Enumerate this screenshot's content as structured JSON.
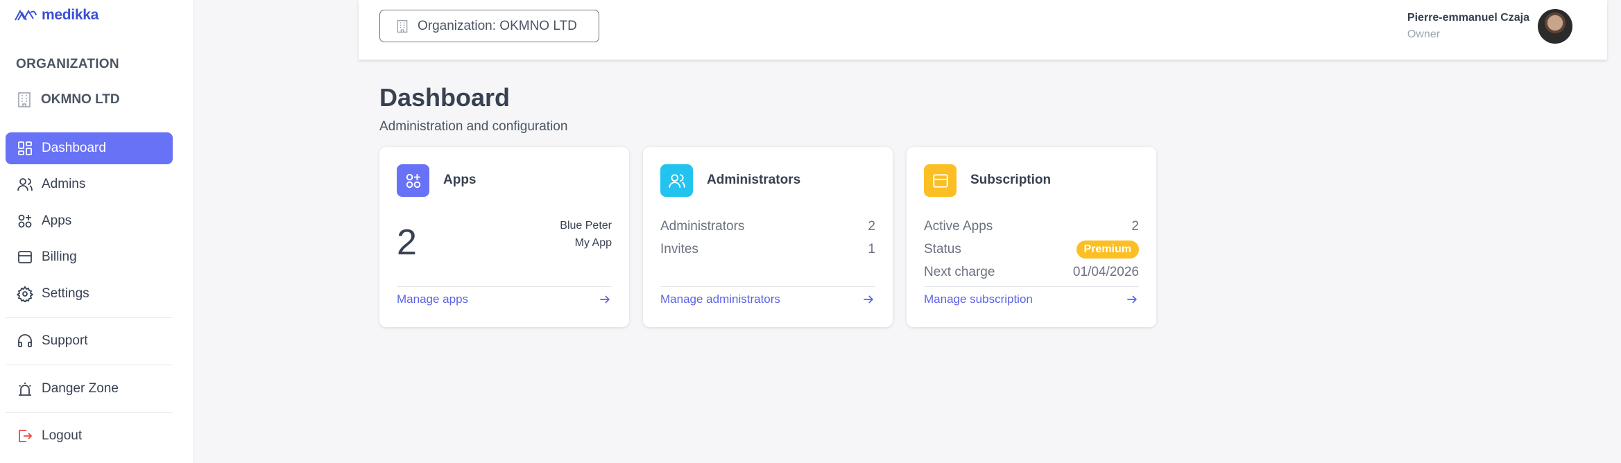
{
  "brand": {
    "name": "medikka",
    "color": "#3b4fd6"
  },
  "sidebar": {
    "section_heading": "ORGANIZATION",
    "org_name": "OKMNO LTD",
    "items": [
      {
        "label": "Dashboard",
        "icon": "dashboard-icon",
        "active": true
      },
      {
        "label": "Admins",
        "icon": "users-icon"
      },
      {
        "label": "Apps",
        "icon": "apps-icon"
      },
      {
        "label": "Billing",
        "icon": "billing-icon"
      },
      {
        "label": "Settings",
        "icon": "gear-icon"
      },
      {
        "label": "Support",
        "icon": "headset-icon"
      },
      {
        "label": "Danger Zone",
        "icon": "alarm-icon"
      },
      {
        "label": "Logout",
        "icon": "logout-icon"
      }
    ],
    "accent": "#6872f6"
  },
  "header": {
    "org_selector": "Organization: OKMNO LTD",
    "user_name": "Pierre-emmanuel Czaja",
    "user_role": "Owner"
  },
  "main": {
    "title": "Dashboard",
    "subtitle": "Administration and configuration",
    "cards": {
      "apps": {
        "title": "Apps",
        "count": "2",
        "app_names": [
          "Blue Peter",
          "My App"
        ],
        "link": "Manage apps",
        "icon_color": "#6872f6"
      },
      "administrators": {
        "title": "Administrators",
        "rows": [
          {
            "label": "Administrators",
            "value": "2"
          },
          {
            "label": "Invites",
            "value": "1"
          }
        ],
        "link": "Manage administrators",
        "icon_color": "#22c3ee"
      },
      "subscription": {
        "title": "Subscription",
        "active_apps_label": "Active Apps",
        "active_apps_value": "2",
        "status_label": "Status",
        "status_value": "Premium",
        "next_charge_label": "Next charge",
        "next_charge_value": "01/04/2026",
        "link": "Manage subscription",
        "icon_color": "#fbbf24"
      }
    }
  }
}
